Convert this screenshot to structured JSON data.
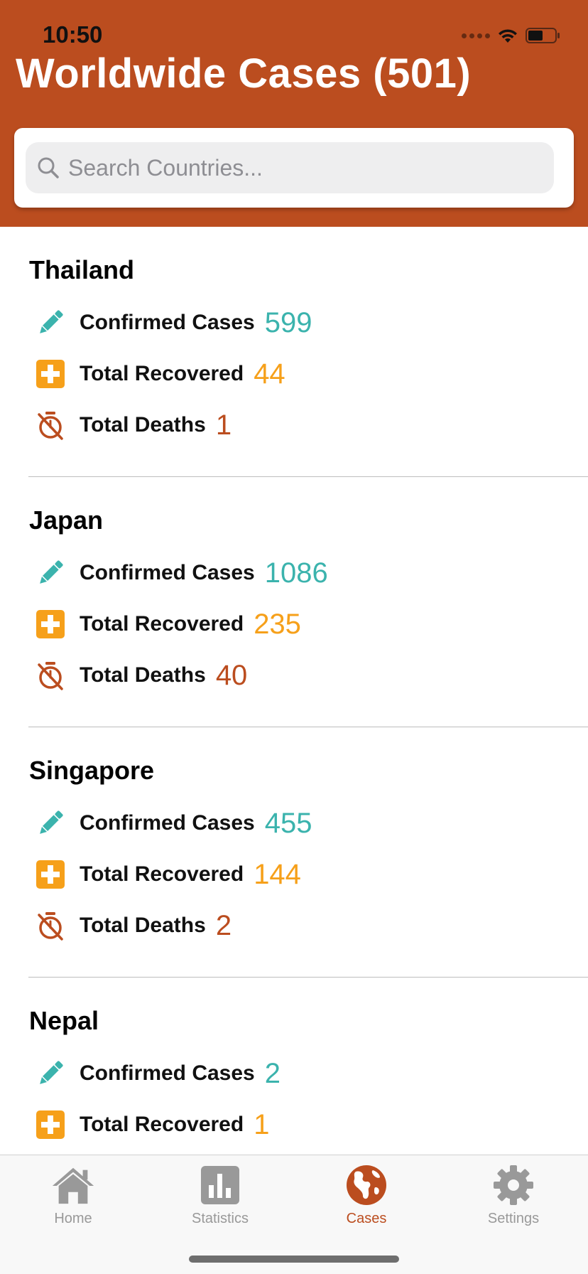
{
  "status_bar": {
    "time": "10:50"
  },
  "header": {
    "title": "Worldwide Cases (501)",
    "search": {
      "placeholder": "Search Countries...",
      "value": ""
    }
  },
  "stat_labels": {
    "confirmed": "Confirmed Cases",
    "recovered": "Total Recovered",
    "deaths": "Total Deaths"
  },
  "countries": [
    {
      "name": "Thailand",
      "confirmed": "599",
      "recovered": "44",
      "deaths": "1"
    },
    {
      "name": "Japan",
      "confirmed": "1086",
      "recovered": "235",
      "deaths": "40"
    },
    {
      "name": "Singapore",
      "confirmed": "455",
      "recovered": "144",
      "deaths": "2"
    },
    {
      "name": "Nepal",
      "confirmed": "2",
      "recovered": "1",
      "deaths": ""
    }
  ],
  "tabbar": {
    "tabs": [
      {
        "label": "Home",
        "icon": "home-icon",
        "active": false
      },
      {
        "label": "Statistics",
        "icon": "bar-chart-icon",
        "active": false
      },
      {
        "label": "Cases",
        "icon": "globe-icon",
        "active": true
      },
      {
        "label": "Settings",
        "icon": "gear-icon",
        "active": false
      }
    ]
  },
  "colors": {
    "brand": "#BB4D1F",
    "confirmed": "#3BB3AD",
    "recovered": "#F6A01A",
    "deaths": "#BB4D1F",
    "inactive_tab": "#999999"
  }
}
